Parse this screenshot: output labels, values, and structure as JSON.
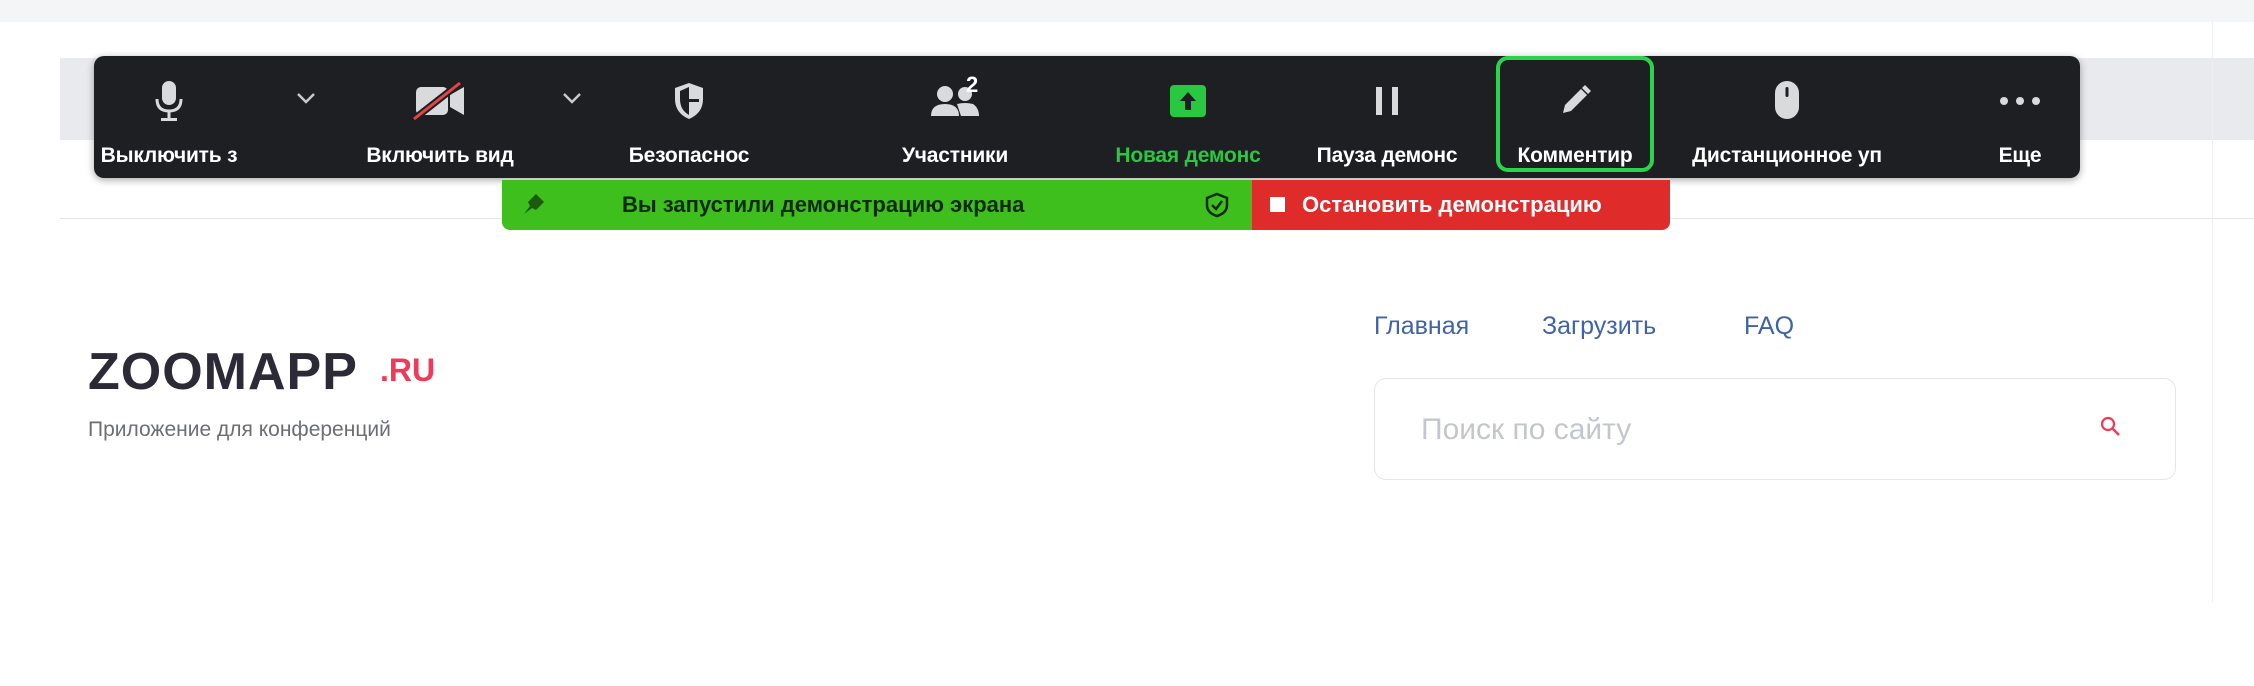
{
  "toolbar": {
    "items": [
      {
        "label": "Выключить з",
        "icon": "microphone-icon"
      },
      {
        "label": "Включить вид",
        "icon": "video-off-icon"
      },
      {
        "label": "Безопаснос",
        "icon": "shield-icon"
      },
      {
        "label": "Участники",
        "icon": "participants-icon",
        "count": "2"
      },
      {
        "label": "Новая демонс",
        "icon": "share-screen-icon"
      },
      {
        "label": "Пауза демонс",
        "icon": "pause-icon"
      },
      {
        "label": "Комментир",
        "icon": "pencil-icon"
      },
      {
        "label": "Дистанционное уп",
        "icon": "mouse-icon"
      },
      {
        "label": "Еще",
        "icon": "more-icon"
      }
    ],
    "highlight_color": "#2bd44a"
  },
  "share_banner": {
    "status_text": "Вы запустили демонстрацию экрана",
    "stop_label": "Остановить демонстрацию",
    "status_color": "#3fbf1e",
    "stop_color": "#e02b2b"
  },
  "site": {
    "logo": "ZOOMAPP",
    "logo_suffix": ".RU",
    "tagline": "Приложение для конференций",
    "nav": [
      "Главная",
      "Загрузить",
      "FAQ"
    ],
    "search_placeholder": "Поиск по сайту",
    "accent_color": "#ef3b57",
    "link_color": "#3f63a8"
  }
}
